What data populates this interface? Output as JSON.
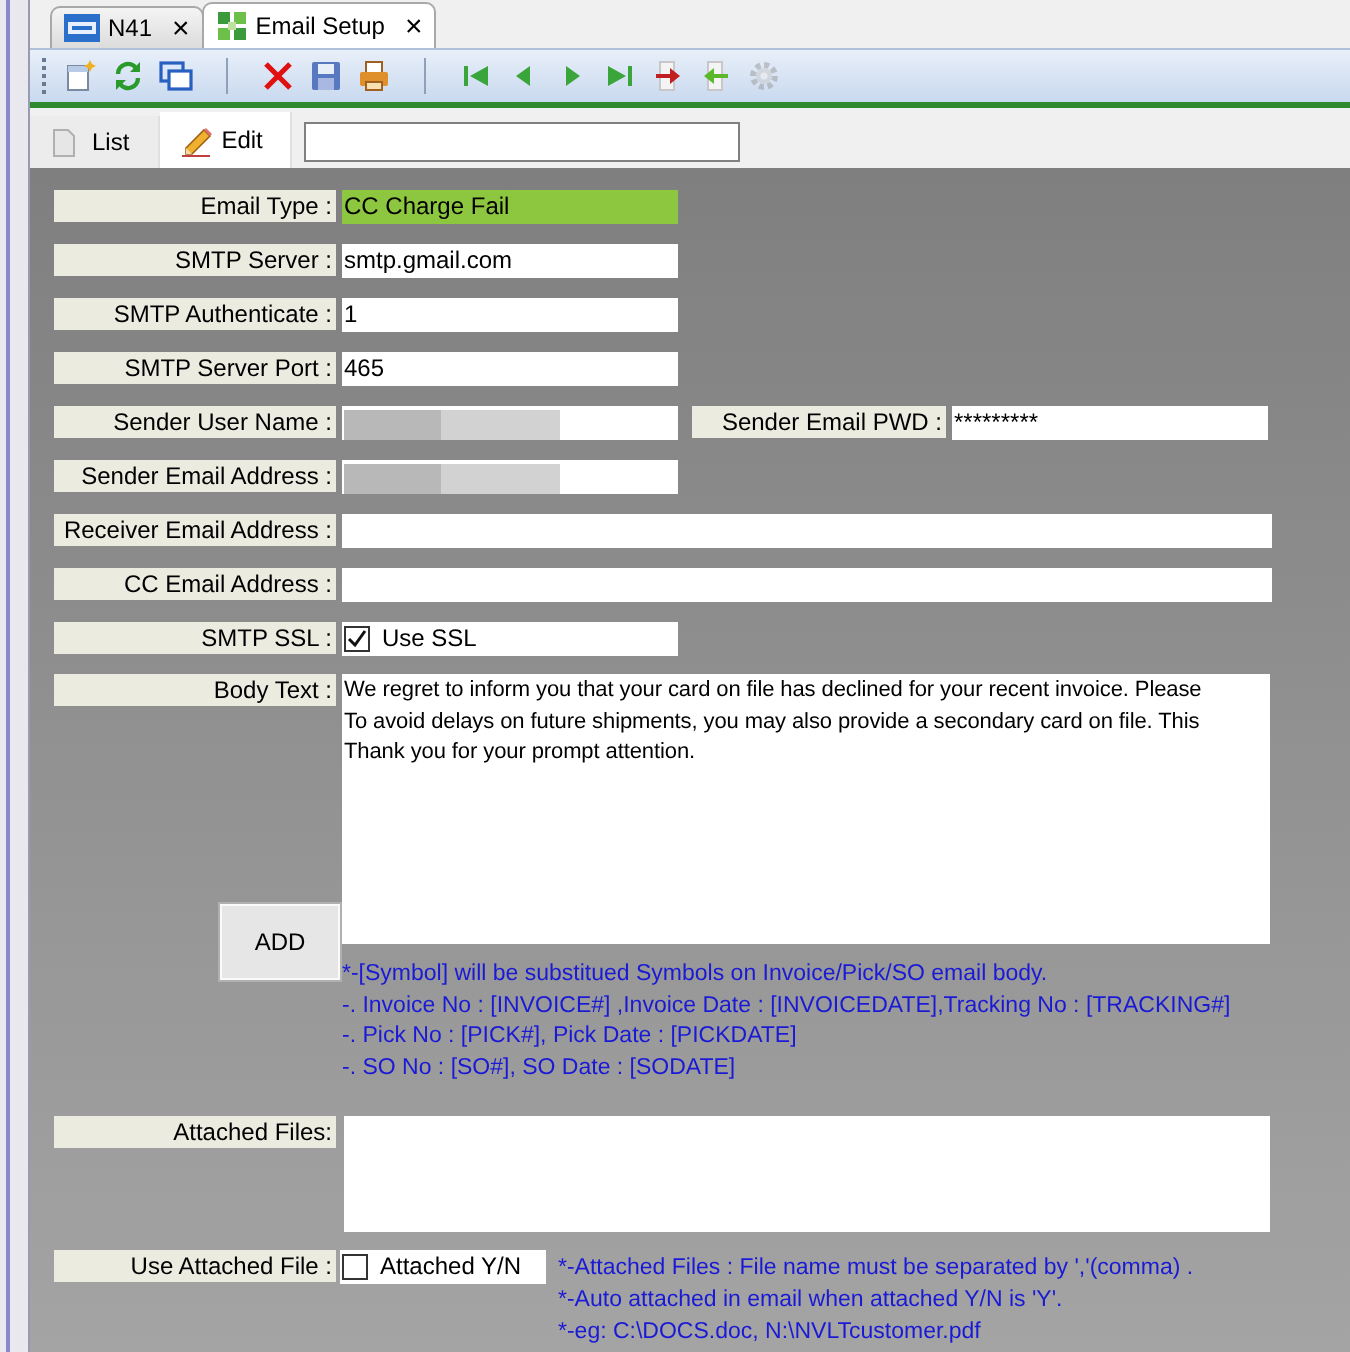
{
  "doc_tabs": [
    {
      "label": "N41",
      "kind": "logo",
      "selected": false,
      "close": "×"
    },
    {
      "label": "Email Setup",
      "kind": "grid",
      "selected": true,
      "close": "×"
    }
  ],
  "toolbar": {
    "groups": [
      [
        {
          "kind": "new",
          "disabled": false
        },
        {
          "kind": "refresh",
          "disabled": false
        },
        {
          "kind": "windows",
          "disabled": false
        }
      ],
      [
        {
          "kind": "delete",
          "disabled": false
        },
        {
          "kind": "save",
          "disabled": false
        },
        {
          "kind": "print",
          "disabled": false
        }
      ],
      [
        {
          "kind": "first",
          "disabled": false
        },
        {
          "kind": "previous",
          "disabled": false
        },
        {
          "kind": "next",
          "disabled": false
        },
        {
          "kind": "last",
          "disabled": false
        },
        {
          "kind": "export",
          "disabled": false
        },
        {
          "kind": "import",
          "disabled": false
        },
        {
          "kind": "settings",
          "disabled": true
        }
      ]
    ]
  },
  "mode_tabs": [
    {
      "label": "List",
      "kind": "list",
      "selected": false
    },
    {
      "label": "Edit",
      "kind": "edit",
      "selected": true
    }
  ],
  "form": {
    "rows": [
      {
        "label": "Email Type :",
        "kind": "short",
        "value": "CC Charge Fail",
        "highlighted": true
      },
      {
        "label": "SMTP Server :",
        "kind": "short",
        "value": "smtp.gmail.com",
        "highlighted": false
      },
      {
        "label": "SMTP Authenticate :",
        "kind": "short",
        "value": "1",
        "highlighted": false
      },
      {
        "label": "SMTP Server Port :",
        "kind": "short",
        "value": "465",
        "highlighted": false
      },
      {
        "label": "Sender User Name :",
        "kind": "short",
        "redacted": true,
        "highlighted": false,
        "side": {
          "label": "Sender Email PWD :",
          "value": "*********"
        }
      },
      {
        "label": "Sender Email Address :",
        "kind": "short",
        "redacted": true,
        "highlighted": false
      },
      {
        "label": "Receiver Email Address :",
        "kind": "wide",
        "highlighted": false
      },
      {
        "label": "CC Email Address :",
        "kind": "wide",
        "highlighted": false
      },
      {
        "label": "SMTP SSL :",
        "kind": "check",
        "checked": true,
        "option": "Use SSL"
      }
    ],
    "body": {
      "label": "Body Text :",
      "lines": [
        "We regret to inform you that your card on file has declined for your recent invoice. Please",
        "To avoid delays on future shipments, you may also provide a secondary card on file. This",
        "Thank you for your prompt attention."
      ],
      "button": "ADD",
      "notes": [
        "*-[Symbol] will be substitued Symbols on Invoice/Pick/SO email body.",
        "-. Invoice No : [INVOICE#] ,Invoice Date : [INVOICEDATE],Tracking No : [TRACKING#]",
        "-. Pick No : [PICK#], Pick Date : [PICKDATE]",
        "-. SO No : [SO#], SO Date : [SODATE]"
      ]
    },
    "attached": {
      "label": "Attached Files:"
    },
    "use_attached": {
      "label": "Use Attached File :",
      "checked": false,
      "option": "Attached Y/N",
      "notes": [
        "*-Attached Files : File name must be separated by ','(comma) .",
        "*-Auto attached in email when attached Y/N is 'Y'.",
        "*-eg: C:\\DOCS.doc, N:\\NVLTcustomer.pdf"
      ]
    }
  }
}
